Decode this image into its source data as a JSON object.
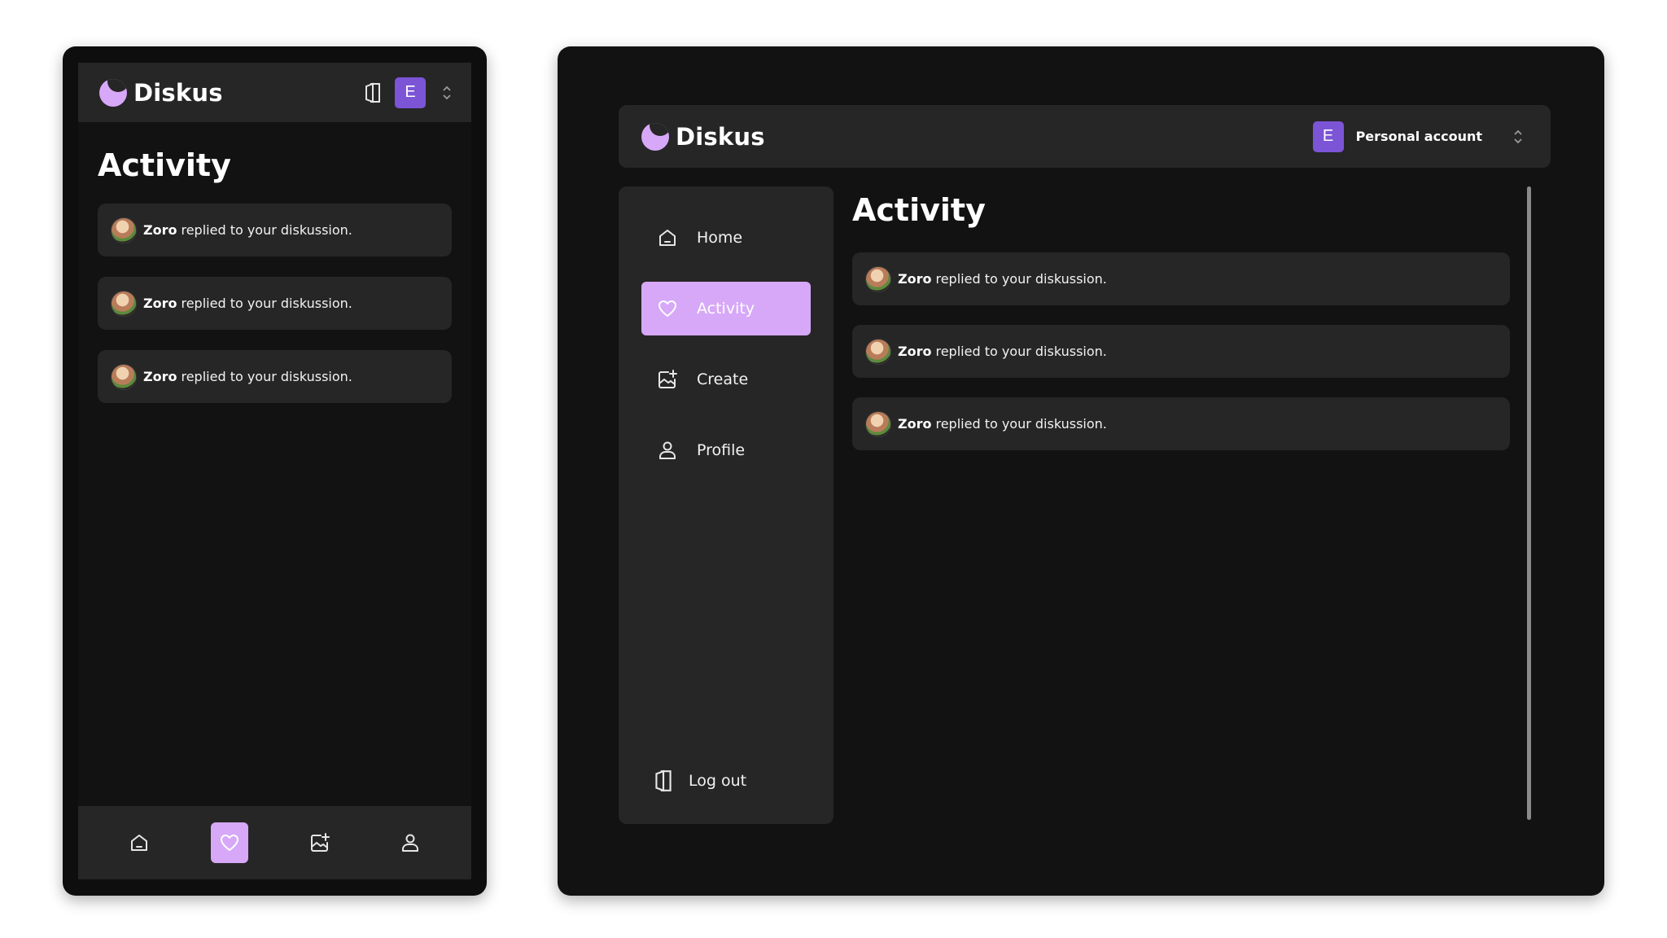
{
  "app": {
    "name": "Diskus",
    "brand_color": "#d6a8f7",
    "avatar_color": "#7b55d6"
  },
  "account": {
    "initial": "E",
    "label": "Personal account"
  },
  "page": {
    "title": "Activity"
  },
  "notifications": [
    {
      "user": "Zoro",
      "text": "replied to your diskussion."
    },
    {
      "user": "Zoro",
      "text": "replied to your diskussion."
    },
    {
      "user": "Zoro",
      "text": "replied to your diskussion."
    }
  ],
  "sidebar": {
    "items": [
      {
        "label": "Home",
        "icon": "home-icon"
      },
      {
        "label": "Activity",
        "icon": "heart-icon",
        "active": true
      },
      {
        "label": "Create",
        "icon": "image-add-icon"
      },
      {
        "label": "Profile",
        "icon": "user-icon"
      }
    ],
    "logout": {
      "label": "Log out",
      "icon": "logout-icon"
    }
  },
  "mobile_nav": {
    "items": [
      {
        "icon": "home-icon"
      },
      {
        "icon": "heart-icon",
        "active": true
      },
      {
        "icon": "image-add-icon"
      },
      {
        "icon": "user-icon"
      }
    ]
  }
}
